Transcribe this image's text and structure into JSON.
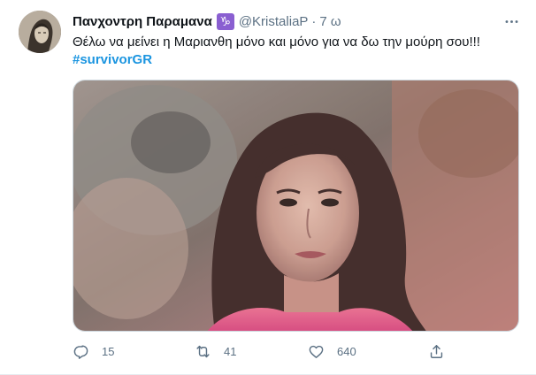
{
  "tweet": {
    "author_name": "Πανχοντρη Παραμανα",
    "badge_symbol": "♑",
    "handle": "@KristaliaP",
    "separator": "·",
    "time": "7 ω",
    "text": "Θέλω να μείνει η Μαριανθη μόνο και μόνο για να δω την μούρη σου!!!",
    "hashtag": "#survivorGR"
  },
  "actions": {
    "replies": "15",
    "retweets": "41",
    "likes": "640"
  },
  "icons": {
    "more": "more-icon",
    "reply": "reply-icon",
    "retweet": "retweet-icon",
    "like": "heart-icon",
    "share": "share-icon"
  },
  "colors": {
    "hashtag": "#1b95e0",
    "muted": "#5b7083",
    "badge": "#8a5fd1"
  }
}
